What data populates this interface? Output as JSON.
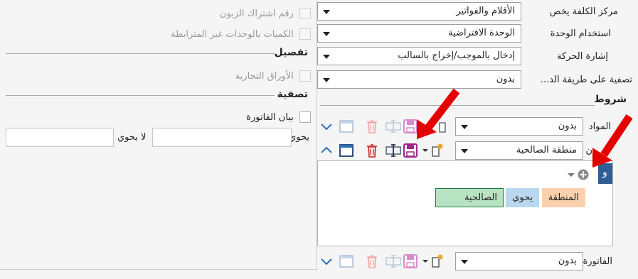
{
  "left": {
    "checkboxes": [
      {
        "label": "رقم اشتراك الزبون",
        "enabled": false
      },
      {
        "label": "الكميات بالوحدات غير المترابطة",
        "enabled": false
      }
    ],
    "detail_section": {
      "title": "تفصيل",
      "checkbox": {
        "label": "الأوراق التجارية",
        "enabled": false
      }
    },
    "filter_section": {
      "title": "تصفية",
      "checkbox": {
        "label": "بيان الفاتورة",
        "enabled": true
      },
      "contains_label": "يحوي",
      "contains_value": "",
      "not_contains_label": "لا يحوي",
      "not_contains_value": ""
    }
  },
  "right": {
    "fields": [
      {
        "label": "مركز الكلفة يخص",
        "value": "الأقلام والفواتير"
      },
      {
        "label": "استخدام الوحدة",
        "value": "الوحدة الافتراضية"
      },
      {
        "label": "إشارة الحركة",
        "value": "إدخال بالموجب/إخراج بالسالب"
      },
      {
        "label": "تصفية على طريقة الد...",
        "value": "بدون"
      }
    ],
    "conditions_title": "شروط",
    "condition_rows": [
      {
        "label": "المواد",
        "value": "بدون"
      },
      {
        "label": "ن",
        "value": "منطقة الصالحية"
      },
      {
        "label": "الفاتورة",
        "value": "بدون"
      }
    ],
    "filter_builder": {
      "and_label": "و",
      "chips": [
        {
          "text": "المنطقة",
          "role": "field"
        },
        {
          "text": "يحوي",
          "role": "operator"
        },
        {
          "text": "الصالحية",
          "role": "value"
        }
      ]
    }
  },
  "colors": {
    "field_chip": "#fbd1ad",
    "operator_chip": "#b9d7ee",
    "value_chip": "#b8e3c2",
    "and_badge": "#2f5d95",
    "accent": "#2a6fb8",
    "delete_red": "#d23a3a",
    "save_purple": "#a0268a",
    "annotation_red": "#e50000"
  }
}
